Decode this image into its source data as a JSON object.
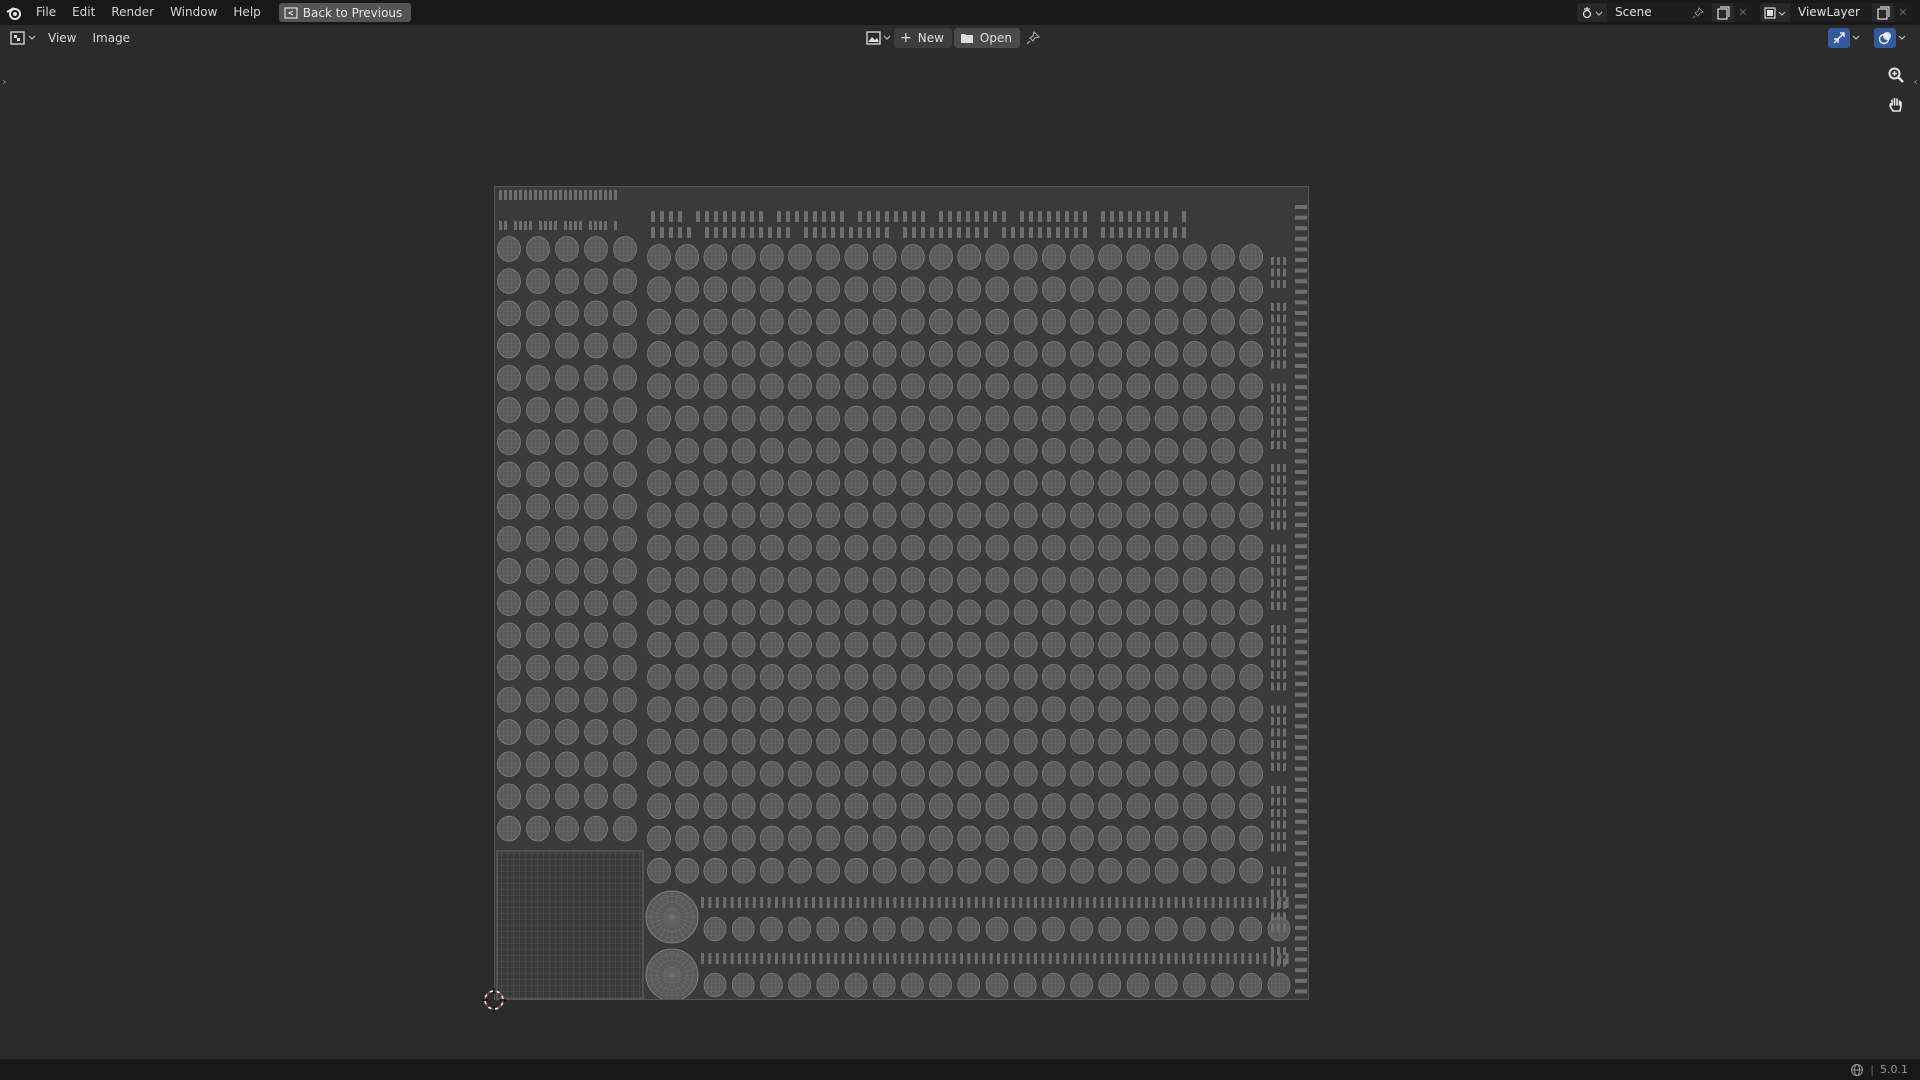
{
  "topbar": {
    "menu": [
      "File",
      "Edit",
      "Render",
      "Window",
      "Help"
    ],
    "back_button": "Back to Previous",
    "scene": {
      "name": "Scene"
    },
    "view_layer": {
      "name": "ViewLayer"
    }
  },
  "header": {
    "menu": [
      "View",
      "Image"
    ],
    "new_label": "New",
    "open_label": "Open"
  },
  "status": {
    "version": "5.0.1"
  },
  "colors": {
    "accent_blue": "#355a9c",
    "uv_fill": "#5a5a5a",
    "uv_wire": "#8a8a8a",
    "cursor_red": "#c83a3a"
  },
  "icons": {
    "logo": "blender-logo-icon",
    "back": "back-to-previous-icon",
    "zoom": "zoom-icon",
    "pan": "hand-pan-icon",
    "cursor": "2d-cursor-icon"
  }
}
